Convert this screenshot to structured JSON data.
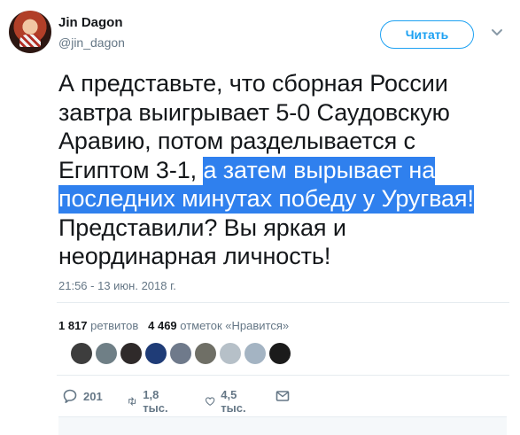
{
  "author": {
    "name": "Jin Dagon",
    "handle": "@jin_dagon"
  },
  "follow_button": {
    "label": "Читать"
  },
  "tweet": {
    "text_lines": [
      "А представьте, что сборная России",
      "завтра выигрывает 5-0 Саудовскую",
      "Аравию, потом разделывается с",
      "Египтом 3-1, "
    ],
    "highlighted_lines": [
      "а затем вырывает на ",
      "последних минутах победу у Уругвая!"
    ],
    "after_lines": [
      "Представили? Вы яркая и",
      "неординарная личность!"
    ],
    "timestamp": "21:56 - 13 июн. 2018 г."
  },
  "stats": {
    "retweets_count": "1 817",
    "retweets_label": "ретвитов",
    "likes_count": "4 469",
    "likes_label": "отметок «Нравится»"
  },
  "likers": [
    {
      "icon": "avatar-person",
      "color": "#3d3d3d"
    },
    {
      "icon": "avatar-cars",
      "color": "#6f7f86"
    },
    {
      "icon": "avatar-glasses",
      "color": "#2f2a2a"
    },
    {
      "icon": "avatar-blue",
      "color": "#1f3c77"
    },
    {
      "icon": "avatar-sky",
      "color": "#6f7a8b"
    },
    {
      "icon": "avatar-pattern",
      "color": "#6f6f66"
    },
    {
      "icon": "avatar-default",
      "color": "#b6c0c8"
    },
    {
      "icon": "avatar-moon",
      "color": "#a4b4c3"
    },
    {
      "icon": "avatar-black",
      "color": "#1b1b1b"
    }
  ],
  "actions": {
    "replies": "201",
    "retweets": "1,8 тыс.",
    "likes": "4,5 тыс."
  },
  "colors": {
    "accent": "#1da1f2",
    "highlight": "#2f80ee",
    "muted": "#657786"
  }
}
